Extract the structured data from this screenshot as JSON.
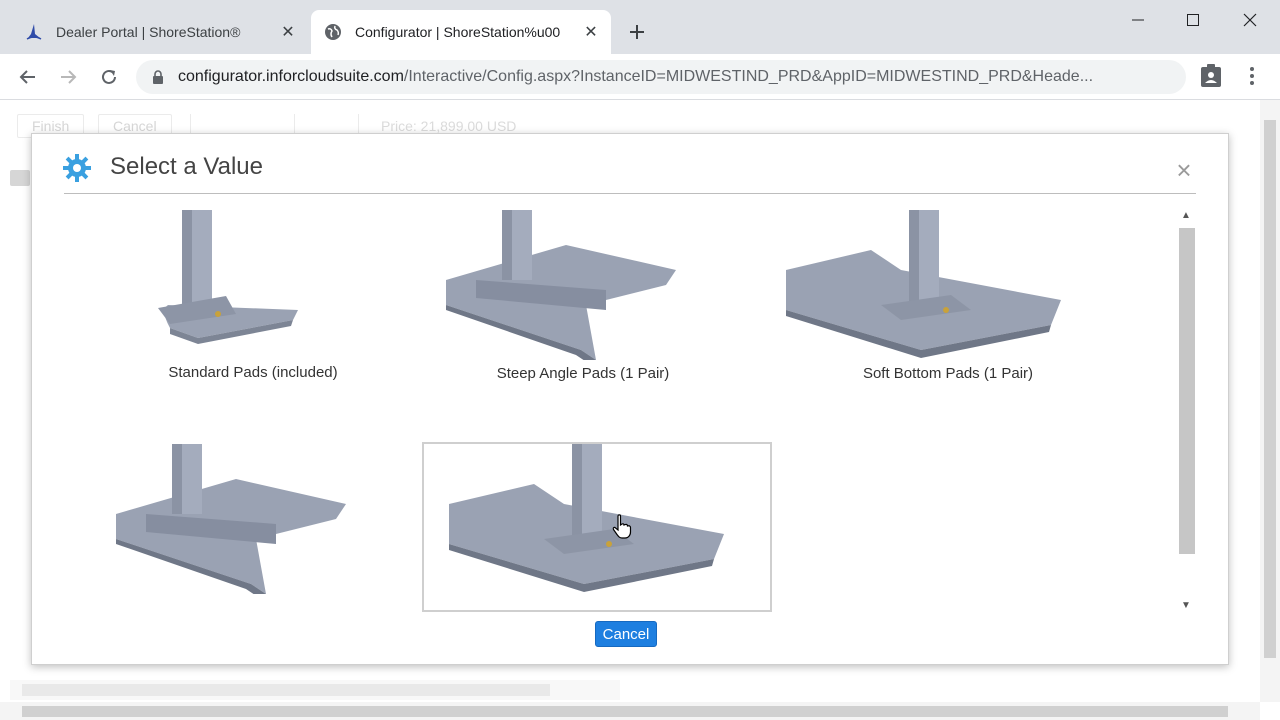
{
  "browser": {
    "tabs": [
      {
        "title": "Dealer Portal | ShoreStation®",
        "icon": "shorestation-logo-icon"
      },
      {
        "title": "Configurator | ShoreStation%u00",
        "icon": "globe-icon"
      }
    ],
    "url_host": "configurator.inforcloudsuite.com",
    "url_path": "/Interactive/Config.aspx?InstanceID=MIDWESTIND_PRD&AppID=MIDWESTIND_PRD&Heade..."
  },
  "page": {
    "finish_label": "Finish",
    "cancel_label": "Cancel",
    "price_text": "Price: 21,899.00 USD"
  },
  "modal": {
    "title": "Select a Value",
    "cancel_label": "Cancel",
    "options": [
      {
        "label": "Standard Pads (included)",
        "variant": "standard"
      },
      {
        "label": "Steep Angle Pads (1 Pair)",
        "variant": "steep"
      },
      {
        "label": "Soft Bottom Pads (1 Pair)",
        "variant": "soft"
      },
      {
        "label": "",
        "variant": "steep"
      },
      {
        "label": "",
        "variant": "soft",
        "selected": true
      }
    ]
  },
  "colors": {
    "accent_blue": "#1e7fe0",
    "gear_blue": "#3aa0e0",
    "part_gray": "#9aa2b3"
  }
}
